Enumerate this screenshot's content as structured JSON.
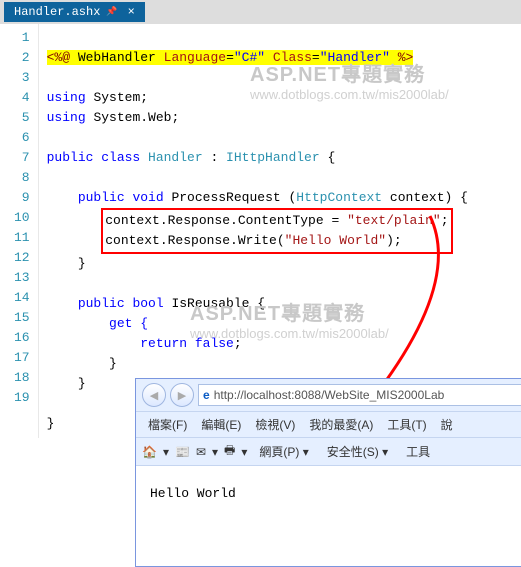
{
  "tab": {
    "filename": "Handler.ashx",
    "pin": "📌",
    "close": "×"
  },
  "code": {
    "l1": {
      "open": "<%@",
      "d": " WebHandler ",
      "lang_k": "Language",
      "eq": "=",
      "lang_v": "\"C#\"",
      "cls_k": " Class",
      "cls_v": "\"Handler\"",
      "close": " %>"
    },
    "l3": {
      "using": "using",
      "sp": " ",
      "ns": "System;"
    },
    "l4": {
      "using": "using",
      "sp": " ",
      "ns": "System.Web;"
    },
    "l6": {
      "pub": "public",
      "cls": " class ",
      "name": "Handler",
      " : ": ": ",
      "iface": "IHttpHandler",
      " {": " {"
    },
    "l8": {
      "pub": "public",
      "vd": " void ",
      "m": "ProcessRequest (",
      "t": "HttpContext",
      "p": " context) {"
    },
    "l9": "context.Response.ContentType = ",
    "l9v": "\"text/plain\"",
    "l10": "context.Response.Write(",
    "l10v": "\"Hello World\"",
    "l11": "}",
    "l13": {
      "pub": "public",
      "bl": " bool ",
      "n": "IsReusable {"
    },
    "l14": "get {",
    "l15": {
      "ret": "return",
      "val": " false",
      ";": ";"
    },
    "l16": "}",
    "l17": "}",
    "l19": "}"
  },
  "wm": {
    "title": "ASP.NET專題實務",
    "url": "www.dotblogs.com.tw/mis2000lab/"
  },
  "browser": {
    "url": "http://localhost:8088/WebSite_MIS2000Lab",
    "menu": [
      "檔案(F)",
      "編輯(E)",
      "檢視(V)",
      "我的最愛(A)",
      "工具(T)",
      "說"
    ],
    "tb": {
      "web": "網頁(P)",
      "safe": "安全性(S)",
      "tool": "工具"
    },
    "output": "Hello World"
  }
}
